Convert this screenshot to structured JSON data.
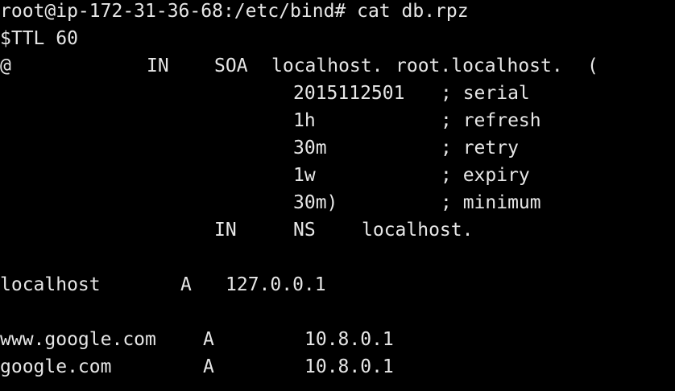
{
  "terminal": {
    "prompt_line": "root@ip-172-31-36-68:/etc/bind# cat db.rpz",
    "ttl_line": "$TTL 60",
    "soa": {
      "origin": "@",
      "class": "IN",
      "type": "SOA",
      "mname": "localhost.",
      "rname": "root.localhost.",
      "open_paren": "("
    },
    "soa_fields": [
      {
        "value": "2015112501",
        "comment": "; serial"
      },
      {
        "value": "1h",
        "comment": "; refresh"
      },
      {
        "value": "30m",
        "comment": "; retry"
      },
      {
        "value": "1w",
        "comment": "; expiry"
      },
      {
        "value": "30m)",
        "comment": "; minimum"
      }
    ],
    "ns_record": {
      "class": "IN",
      "type": "NS",
      "target": "localhost."
    },
    "records": [
      {
        "name": "localhost",
        "type": "A",
        "address": "127.0.0.1"
      },
      {
        "name": "www.google.com",
        "type": "A",
        "address": "10.8.0.1"
      },
      {
        "name": "google.com",
        "type": "A",
        "address": "10.8.0.1"
      }
    ],
    "colors": {
      "background": "#000000",
      "foreground": "#e6e6e6"
    }
  }
}
